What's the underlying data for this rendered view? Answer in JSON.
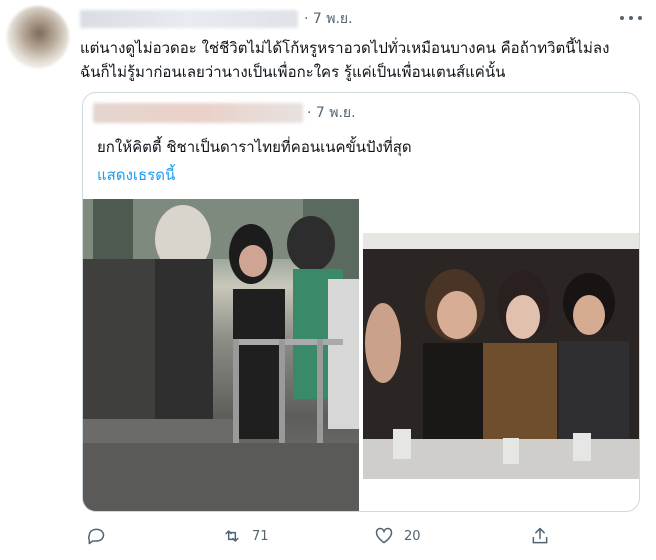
{
  "tweet": {
    "meta": "· 7 พ.ย.",
    "text_line_1": "แต่นางดูไม่อวดอะ ใช่ชีวิตไม่ได้โก้หรูหราอวดไปทั่วเหมือนบางคน คือถ้าทวิตนี้ไม่ลง",
    "text_line_2": "ฉันก็ไม่รู้มาก่อนเลยว่านางเป็นเพื่อกะใคร รู้แค่เป็นเพื่อนเตนส์แค่นั้น"
  },
  "quote": {
    "meta": "· 7 พ.ย.",
    "text": "ยกให้คิตตี้ ชิชาเป็นดาราไทยที่คอนเนคขั้นปังที่สุด",
    "link": "แสดงเธรดนี้"
  },
  "actions": {
    "reply_icon": "reply-icon",
    "retweet_icon": "retweet-icon",
    "retweet_count": "71",
    "like_icon": "heart-icon",
    "like_count": "20",
    "share_icon": "share-icon"
  },
  "colors": {
    "text": "#0f1419",
    "muted": "#536471",
    "link": "#1d9bf0",
    "border": "#cfd9de"
  }
}
